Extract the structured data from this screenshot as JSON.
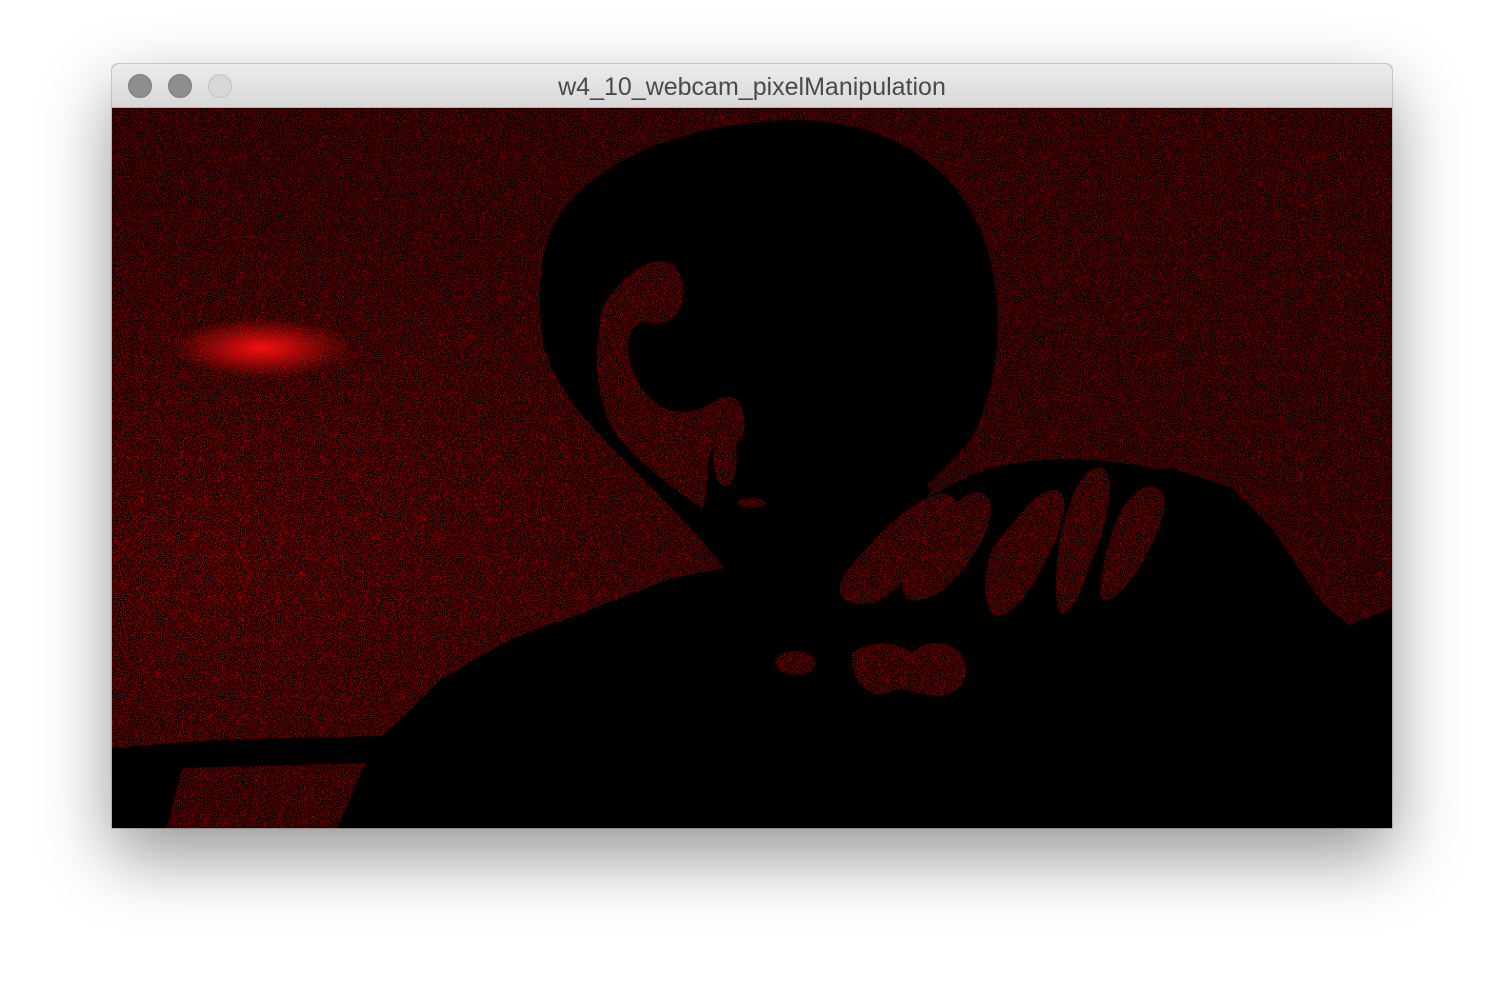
{
  "window": {
    "title": "w4_10_webcam_pixelManipulation",
    "buttons": {
      "close": "close-button",
      "minimize": "minimize-button",
      "zoom": "zoom-button"
    }
  },
  "canvas": {
    "description_colors": {
      "foreground": "#e00000",
      "background": "#000000"
    }
  }
}
